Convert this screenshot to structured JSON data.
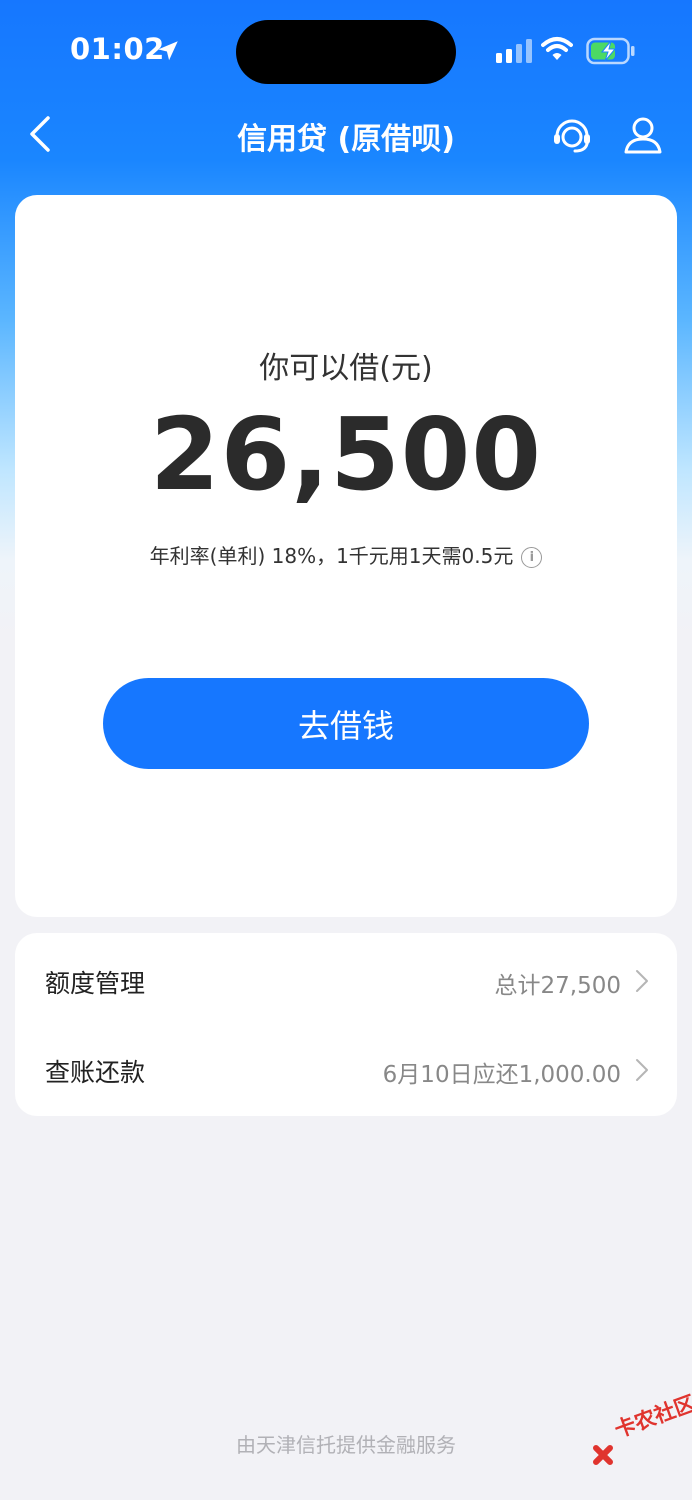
{
  "status_bar": {
    "time": "01:02"
  },
  "nav": {
    "title": "信用贷 (原借呗)"
  },
  "loan": {
    "label": "你可以借(元)",
    "amount": "26,500",
    "rate_text": "年利率(单利) 18%，1千元用1天需0.5元",
    "button_label": "去借钱"
  },
  "menu": {
    "items": [
      {
        "label": "额度管理",
        "value": "总计27,500"
      },
      {
        "label": "查账还款",
        "value": "6月10日应还1,000.00"
      }
    ]
  },
  "footer": {
    "text": "由天津信托提供金融服务"
  },
  "watermark": {
    "text": "卡农社区"
  },
  "colors": {
    "accent": "#1677ff",
    "background": "#f2f2f6",
    "card": "#ffffff",
    "battery_fill": "#4cd964"
  }
}
